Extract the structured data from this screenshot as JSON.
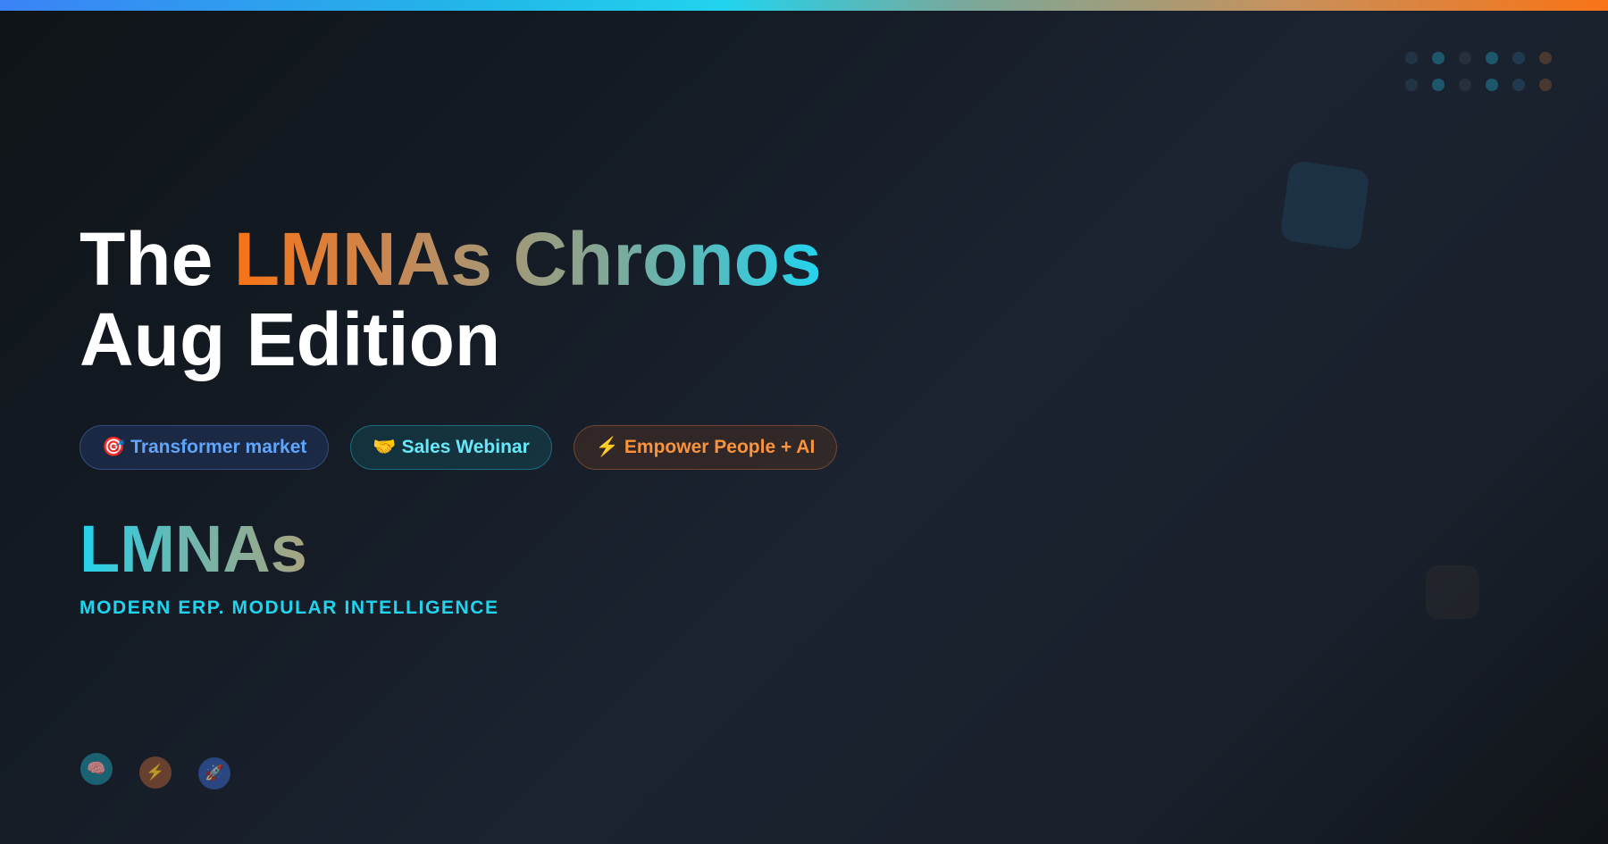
{
  "colors": {
    "accent_orange": "#f97316",
    "accent_cyan": "#22d3ee",
    "accent_blue": "#3b82f6",
    "background": "#161d27"
  },
  "title": {
    "line1_prefix": "The ",
    "line1_highlight": "LMNAs Chronos",
    "line2": "Aug Edition"
  },
  "pills": [
    {
      "emoji": "🎯",
      "label": "Transformer market"
    },
    {
      "emoji": "🤝",
      "label": "Sales Webinar"
    },
    {
      "emoji": "⚡",
      "label": "Empower People + AI"
    }
  ],
  "logo": "LMNAs",
  "tagline": "MODERN ERP. MODULAR INTELLIGENCE",
  "bubbles": [
    {
      "emoji": "🧠",
      "icon": "brain-icon"
    },
    {
      "emoji": "⚡",
      "icon": "lightning-icon"
    },
    {
      "emoji": "🚀",
      "icon": "rocket-icon"
    }
  ]
}
